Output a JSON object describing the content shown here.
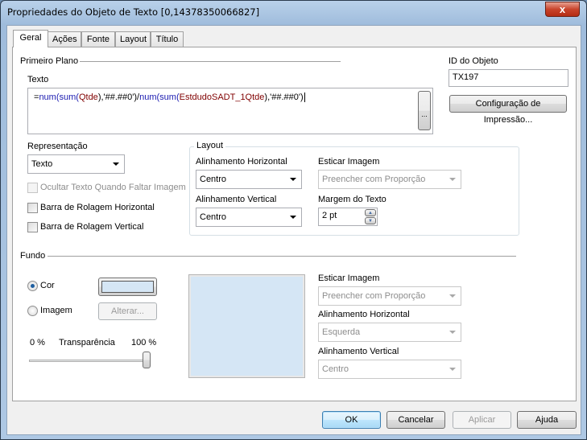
{
  "window": {
    "title": "Propriedades do Objeto de Texto [0,14378350066827]",
    "close": "x"
  },
  "tabs": [
    "Geral",
    "Ações",
    "Fonte",
    "Layout",
    "Título"
  ],
  "foreground": {
    "section": "Primeiro Plano",
    "text_label": "Texto",
    "expression_tokens": [
      {
        "t": "=",
        "c": ""
      },
      {
        "t": "num(",
        "c": "kw"
      },
      {
        "t": "sum(",
        "c": "kw"
      },
      {
        "t": "Qtde",
        "c": "fld"
      },
      {
        "t": "),'##.##0')/",
        "c": ""
      },
      {
        "t": "num(",
        "c": "kw"
      },
      {
        "t": "sum(",
        "c": "kw"
      },
      {
        "t": "EstdudoSADT_1Qtde",
        "c": "fld"
      },
      {
        "t": "),'##.##0')",
        "c": ""
      }
    ],
    "ellipsis": "...",
    "object_id_label": "ID do Objeto",
    "object_id": "TX197",
    "print_settings": "Configuração de Impressão...",
    "representation_label": "Representação",
    "representation": "Texto",
    "hide_text": "Ocultar Texto Quando Faltar Imagem",
    "hscroll": "Barra de Rolagem Horizontal",
    "vscroll": "Barra de Rolagem Vertical",
    "layout": {
      "title": "Layout",
      "h_align_label": "Alinhamento Horizontal",
      "h_align": "Centro",
      "stretch_label": "Esticar Imagem",
      "stretch": "Preencher com Proporção",
      "v_align_label": "Alinhamento Vertical",
      "v_align": "Centro",
      "margin_label": "Margem do Texto",
      "margin": "2 pt"
    }
  },
  "background": {
    "section": "Fundo",
    "color_label": "Cor",
    "image_label": "Imagem",
    "change": "Alterar...",
    "min": "0 %",
    "transparency_label": "Transparência",
    "max": "100 %",
    "transparency_value": 100,
    "color": "#d5e6f5",
    "stretch_label": "Esticar Imagem",
    "stretch": "Preencher com Proporção",
    "h_align_label": "Alinhamento Horizontal",
    "h_align": "Esquerda",
    "v_align_label": "Alinhamento Vertical",
    "v_align": "Centro"
  },
  "buttons": {
    "ok": "OK",
    "cancel": "Cancelar",
    "apply": "Aplicar",
    "help": "Ajuda"
  }
}
